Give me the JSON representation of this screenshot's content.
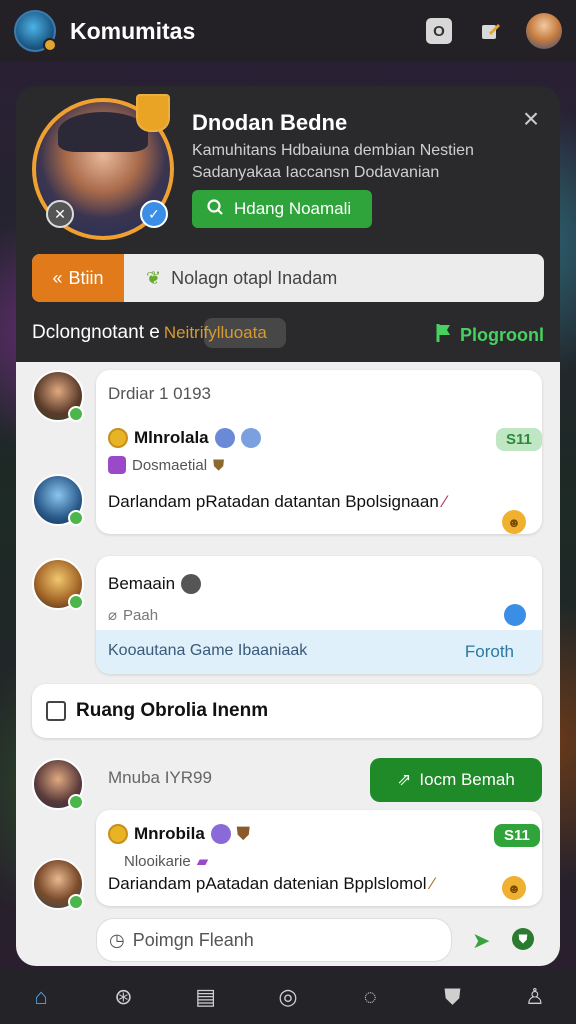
{
  "app": {
    "title": "Komumitas"
  },
  "topbar": {
    "icons": [
      "square-o-icon",
      "edit-icon",
      "profile-avatar"
    ],
    "sq_icon": "O"
  },
  "profile": {
    "name": "Dnodan Bedne",
    "description": "Kamuhitans Hdbaiuna dembian Nestien Sadanyakaa Iaccansn Dodavanian",
    "join_label": "Hdang Noamali",
    "close": "×"
  },
  "search": {
    "button_label": "Btiin",
    "placeholder": "Nolagn otapl Inadam"
  },
  "section": {
    "label": "Dclongnotant e",
    "sublabel": "Neitrifylluoata",
    "right_label": "Plogroonl"
  },
  "posts": [
    {
      "header": "Drdiar 1 0193",
      "username": "Mlnrolala",
      "subtitle": "Dosmaetial",
      "badge": "S11",
      "text": "Darlandam pRatadan datantan Bpolsignaan"
    },
    {
      "header": "Bemaain",
      "subtitle": "Paah",
      "link_text": "Kooautana Game Ibaaniaak",
      "link_action": "Foroth"
    }
  ],
  "checkbox": {
    "label": "Ruang Obrolia Inenm"
  },
  "post3": {
    "header": "Mnuba IYR99",
    "action_label": "Iocm Bemah",
    "username": "Mnrobila",
    "subtitle": "Nlooikarie",
    "badge": "S11",
    "text": "Dariandam pAatadan datenian Bpplslomol"
  },
  "comment": {
    "placeholder": "Poimgn Fleanh"
  },
  "bottom_nav": [
    "home-icon",
    "game-icon",
    "list-icon",
    "compass-icon",
    "chat-icon",
    "shield-icon",
    "user-icon"
  ],
  "colors": {
    "accent_green": "#2fa43a",
    "accent_orange": "#e07a1a",
    "nav_active": "#4aa6ee"
  }
}
